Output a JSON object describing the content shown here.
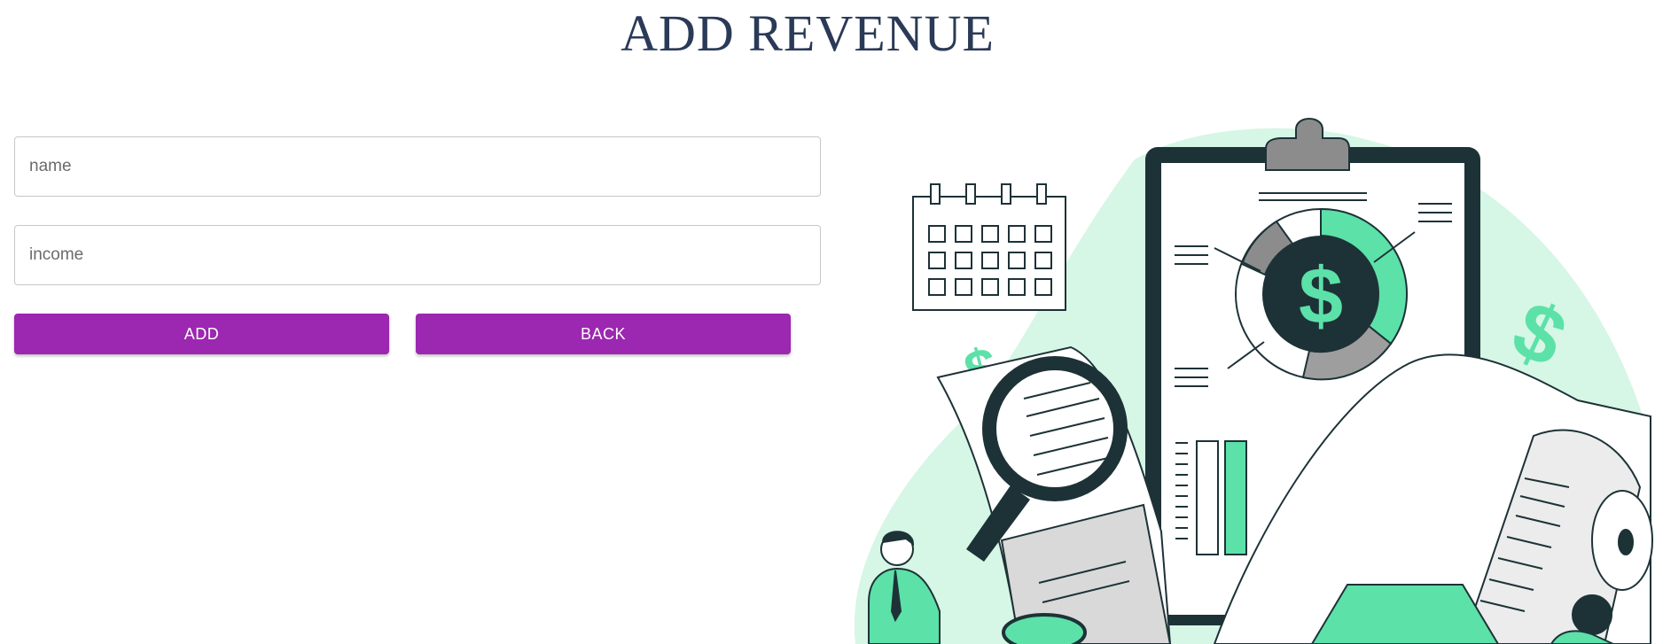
{
  "header": {
    "title": "ADD REVENUE"
  },
  "form": {
    "name_placeholder": "name",
    "income_placeholder": "income",
    "add_label": "ADD",
    "back_label": "BACK"
  },
  "illustration": {
    "icon": "revenue-accounting-illustration"
  },
  "colors": {
    "title": "#2a3a57",
    "button": "#9c27b0",
    "accent_green": "#5ce1a8",
    "mint_bg": "#d6f6e6",
    "dark": "#1d3237"
  }
}
